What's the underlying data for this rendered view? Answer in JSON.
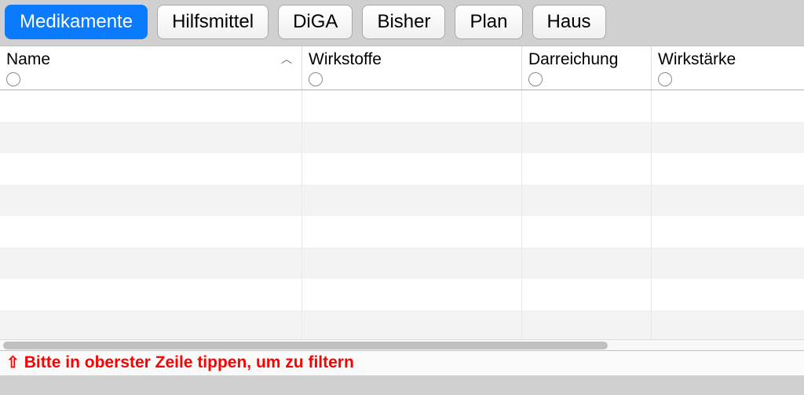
{
  "tabs": [
    {
      "label": "Medikamente",
      "active": true
    },
    {
      "label": "Hilfsmittel",
      "active": false
    },
    {
      "label": "DiGA",
      "active": false
    },
    {
      "label": "Bisher",
      "active": false
    },
    {
      "label": "Plan",
      "active": false
    },
    {
      "label": "Haus",
      "active": false
    }
  ],
  "columns": {
    "name": {
      "label": "Name",
      "sorted_asc": true
    },
    "wirkstoffe": {
      "label": "Wirkstoffe"
    },
    "darreichung": {
      "label": "Darreichung"
    },
    "wirkstaerke": {
      "label": "Wirkstärke"
    }
  },
  "status": {
    "icon_glyph": "⇧",
    "text": "Bitte in oberster Zeile tippen, um zu filtern"
  },
  "colors": {
    "accent": "#0a7bff",
    "status_text": "#ff0000"
  }
}
